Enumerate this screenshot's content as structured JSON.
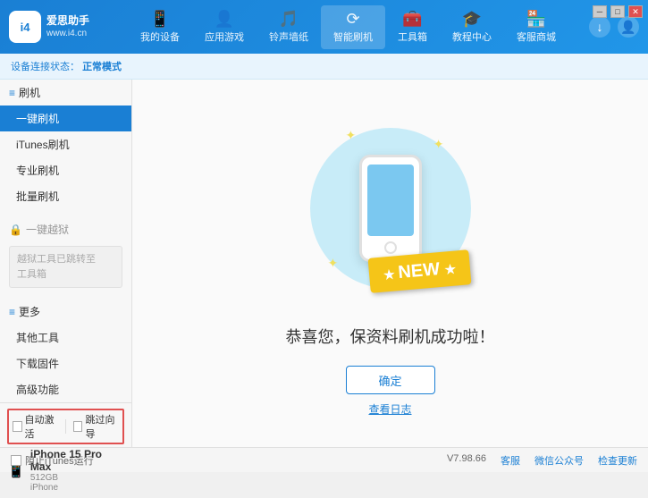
{
  "app": {
    "logo_text_line1": "爱思助手",
    "logo_text_line2": "www.i4.cn",
    "logo_abbr": "i4"
  },
  "nav": {
    "items": [
      {
        "id": "my-device",
        "icon": "📱",
        "label": "我的设备"
      },
      {
        "id": "app-games",
        "icon": "👤",
        "label": "应用游戏"
      },
      {
        "id": "ringtones",
        "icon": "🎵",
        "label": "铃声墙纸"
      },
      {
        "id": "smart-flash",
        "icon": "⟳",
        "label": "智能刷机",
        "active": true
      },
      {
        "id": "toolbox",
        "icon": "🧰",
        "label": "工具箱"
      },
      {
        "id": "tutorial",
        "icon": "🎓",
        "label": "教程中心"
      },
      {
        "id": "store",
        "icon": "🏪",
        "label": "客服商城"
      }
    ]
  },
  "breadcrumb": {
    "prefix": "设备连接状态：",
    "status": "正常模式"
  },
  "sidebar": {
    "section_flash": "刷机",
    "items": [
      {
        "id": "one-key-flash",
        "label": "一键刷机",
        "active": true
      },
      {
        "id": "itunes-flash",
        "label": "iTunes刷机"
      },
      {
        "id": "pro-flash",
        "label": "专业刷机"
      },
      {
        "id": "batch-flash",
        "label": "批量刷机"
      }
    ],
    "section_jailbreak": "一键越狱",
    "disabled_notice_line1": "越狱工具已跳转至",
    "disabled_notice_line2": "工具箱",
    "section_more": "更多",
    "more_items": [
      {
        "id": "other-tools",
        "label": "其他工具"
      },
      {
        "id": "download-firmware",
        "label": "下载固件"
      },
      {
        "id": "advanced",
        "label": "高级功能"
      }
    ]
  },
  "device_controls": {
    "auto_activate_label": "自动激活",
    "skip_backup_label": "跳过向导"
  },
  "device": {
    "name": "iPhone 15 Pro Max",
    "storage": "512GB",
    "type": "iPhone"
  },
  "content": {
    "success_message": "恭喜您，保资料刷机成功啦！",
    "confirm_button": "确定",
    "log_link": "查看日志",
    "new_badge": "NEW"
  },
  "footer": {
    "stop_itunes_label": "阻止iTunes运行",
    "version": "V7.98.66",
    "links": [
      "客服",
      "微信公众号",
      "检查更新"
    ]
  },
  "win_controls": [
    "─",
    "□",
    "✕"
  ]
}
